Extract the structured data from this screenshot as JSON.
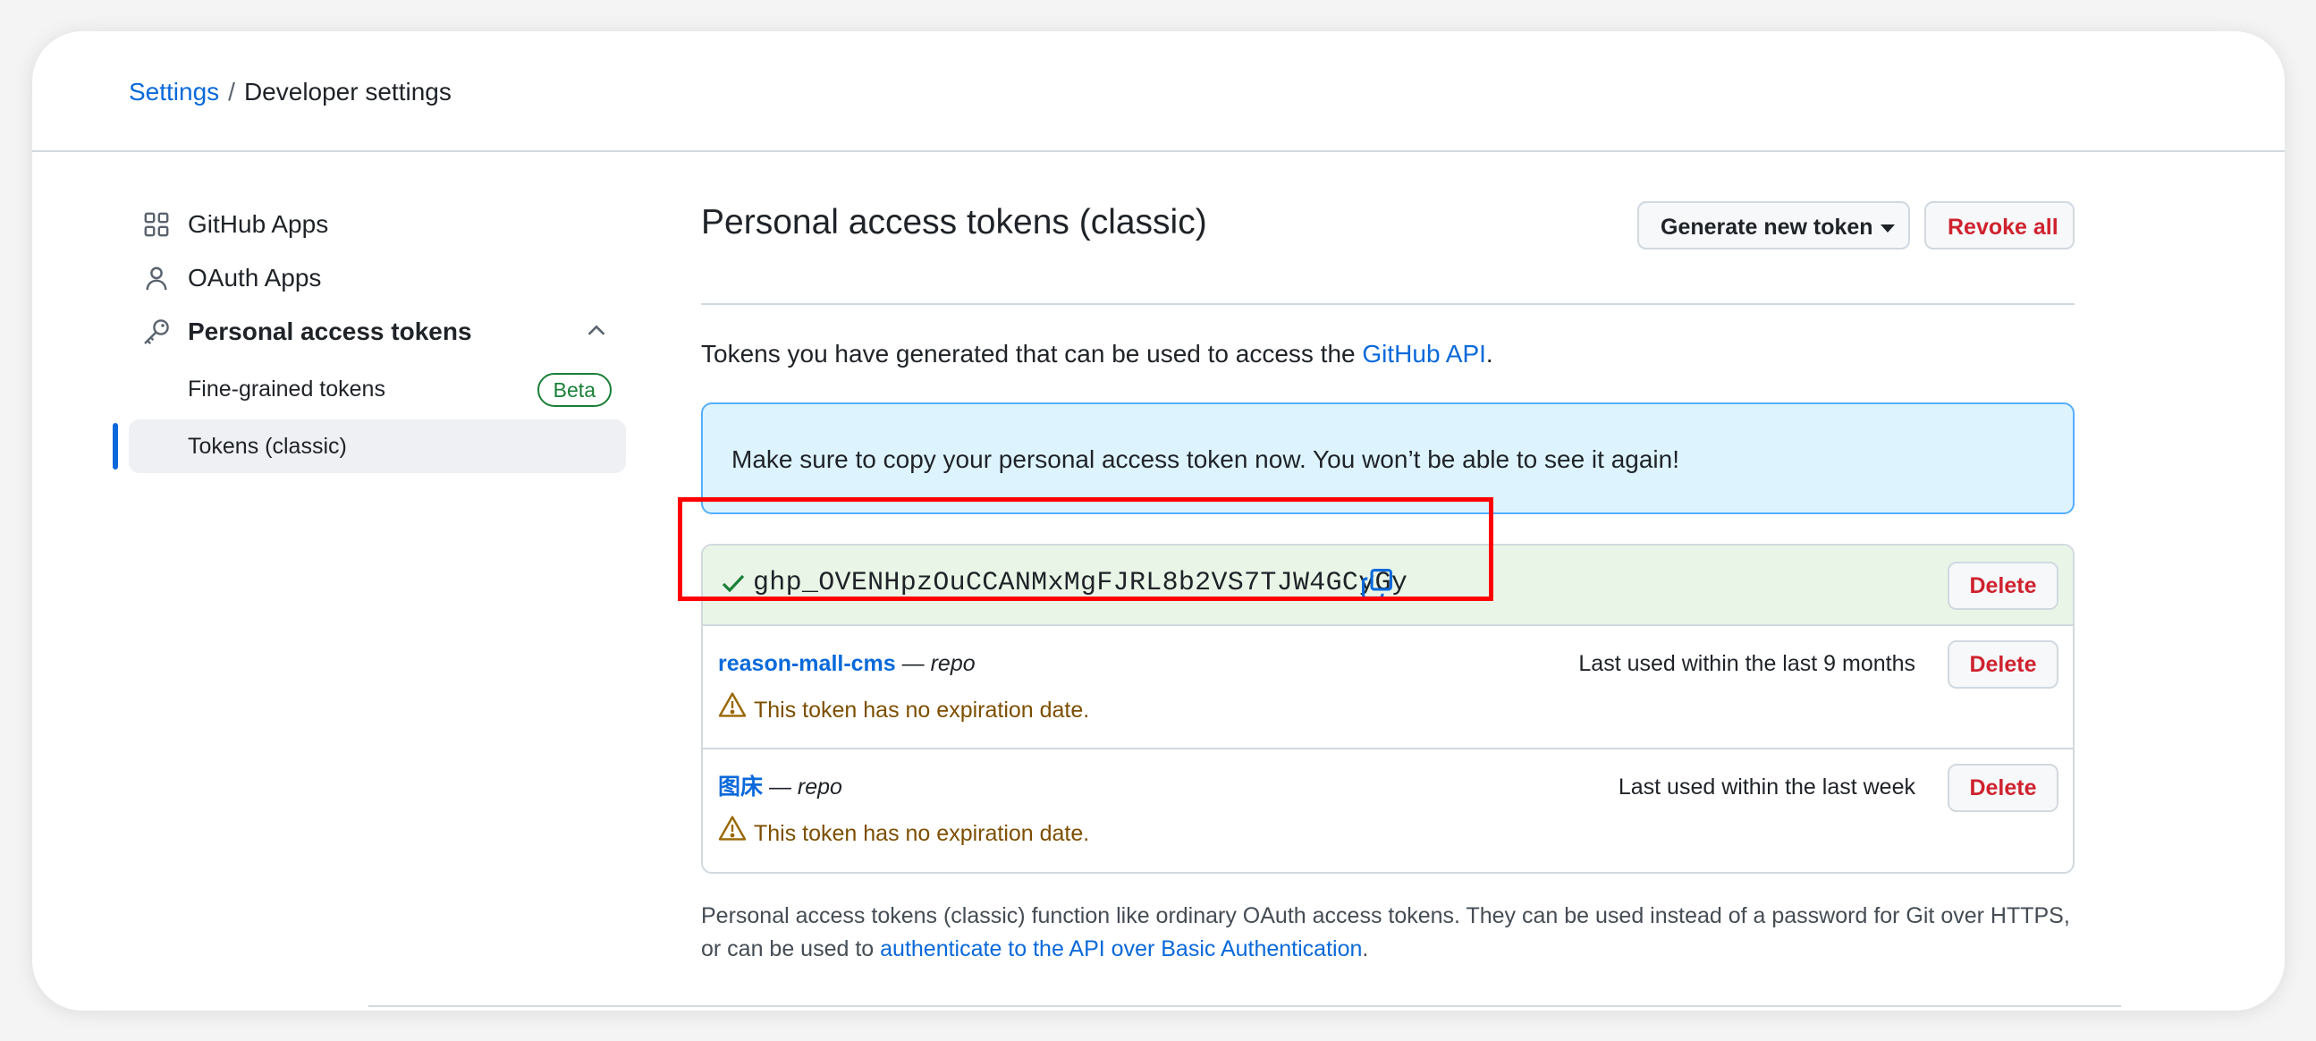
{
  "breadcrumb": {
    "settings": "Settings",
    "separator": "/",
    "current": "Developer settings"
  },
  "sidebar": {
    "items": [
      {
        "label": "GitHub Apps",
        "icon": "apps-grid-icon"
      },
      {
        "label": "OAuth Apps",
        "icon": "person-icon"
      },
      {
        "label": "Personal access tokens",
        "icon": "key-icon",
        "expanded": true
      }
    ],
    "sub_items": [
      {
        "label": "Fine-grained tokens",
        "badge": "Beta"
      },
      {
        "label": "Tokens (classic)",
        "active": true
      }
    ]
  },
  "main": {
    "title": "Personal access tokens (classic)",
    "generate_button": "Generate new token",
    "revoke_button": "Revoke all",
    "intro_text": "Tokens you have generated that can be used to access the ",
    "intro_link": "GitHub API",
    "intro_end": ".",
    "flash_message": "Make sure to copy your personal access token now. You won’t be able to see it again!",
    "new_token": {
      "value": "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",
      "delete_label": "Delete"
    },
    "tokens": [
      {
        "name": "reason-mall-cms",
        "dash": " — ",
        "scope": "repo",
        "last_used": "Last used within the last 9 months",
        "warning": "This token has no expiration date.",
        "delete_label": "Delete"
      },
      {
        "name": "图床",
        "dash": " — ",
        "scope": "repo",
        "last_used": "Last used within the last week",
        "warning": "This token has no expiration date.",
        "delete_label": "Delete"
      }
    ],
    "footer_text": "Personal access tokens (classic) function like ordinary OAuth access tokens. They can be used instead of a password for Git over HTTPS, or can be used to ",
    "footer_link": "authenticate to the API over Basic Authentication",
    "footer_end": "."
  },
  "colors": {
    "link": "#0969da",
    "danger": "#cf222e",
    "success": "#1a7f37",
    "flash_bg": "#ddf4ff",
    "new_token_bg": "#e9f6e7",
    "annotation": "#ff0000"
  }
}
